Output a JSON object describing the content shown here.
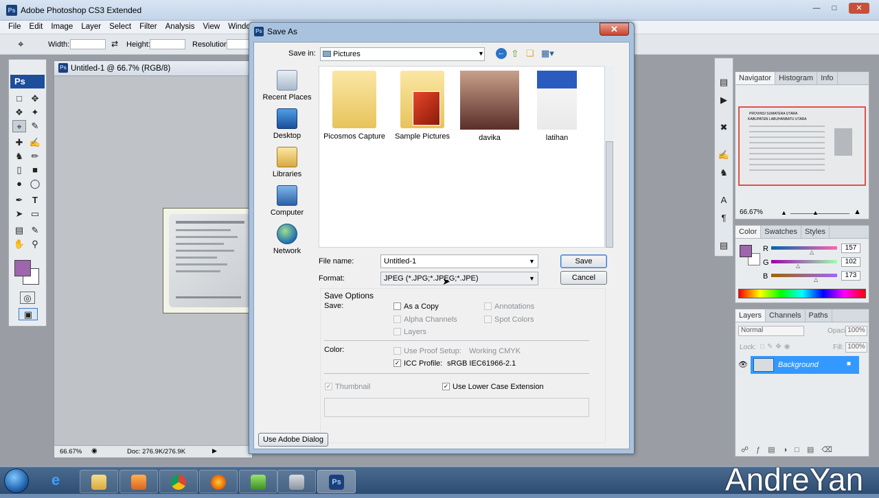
{
  "app": {
    "title": "Adobe Photoshop CS3 Extended",
    "logo": "Ps",
    "menu": [
      "File",
      "Edit",
      "Image",
      "Layer",
      "Select",
      "Filter",
      "Analysis",
      "View",
      "Windo"
    ],
    "options": {
      "width_label": "Width:",
      "height_label": "Height:",
      "resolution_label": "Resolution:"
    }
  },
  "document": {
    "tab_title": "Untitled-1 @ 66.7% (RGB/8)",
    "zoom": "66.67%",
    "doc_size": "Doc: 276.9K/276.9K"
  },
  "navigator": {
    "tabs": [
      "Navigator",
      "Histogram",
      "Info"
    ],
    "zoom": "66.67%",
    "thumb_lines": [
      "PROVINSI SUMATERA UTARA",
      "KABUPATEN LABUHANBATU UTARA"
    ]
  },
  "color_panel": {
    "tabs": [
      "Color",
      "Swatches",
      "Styles"
    ],
    "channels": [
      {
        "label": "R",
        "value": "157"
      },
      {
        "label": "G",
        "value": "102"
      },
      {
        "label": "B",
        "value": "173"
      }
    ],
    "levels": {
      "R": 157,
      "G": 102,
      "B": 173
    },
    "foreground": "#9d66ad"
  },
  "layers_panel": {
    "tabs": [
      "Layers",
      "Channels",
      "Paths"
    ],
    "blend_mode": "Normal",
    "opacity_label": "Opacity:",
    "opacity": "100%",
    "lock_label": "Lock:",
    "fill_label": "Fill:",
    "fill": "100%",
    "layer_name": "Background"
  },
  "dialog": {
    "title": "Save As",
    "save_in_label": "Save in:",
    "save_in_value": "Pictures",
    "places": [
      "Recent Places",
      "Desktop",
      "Libraries",
      "Computer",
      "Network"
    ],
    "files": [
      "Picosmos Capture",
      "Sample Pictures",
      "davika",
      "latihan"
    ],
    "file_name_label": "File name:",
    "file_name_value": "Untitled-1",
    "format_label": "Format:",
    "format_value": "JPEG (*.JPG;*.JPEG;*.JPE)",
    "save_button": "Save",
    "cancel_button": "Cancel",
    "save_options_title": "Save Options",
    "save_label": "Save:",
    "opt_as_copy": "As a Copy",
    "opt_annotations": "Annotations",
    "opt_alpha": "Alpha Channels",
    "opt_spot": "Spot Colors",
    "opt_layers": "Layers",
    "color_label": "Color:",
    "opt_proof": "Use Proof Setup:",
    "proof_value": "Working CMYK",
    "opt_icc": "ICC Profile:",
    "icc_value": "sRGB IEC61966-2.1",
    "opt_thumbnail": "Thumbnail",
    "opt_lowercase": "Use Lower Case Extension",
    "use_adobe_dialog": "Use Adobe Dialog"
  },
  "watermark": "AndreYan",
  "accent": "#3399ff"
}
